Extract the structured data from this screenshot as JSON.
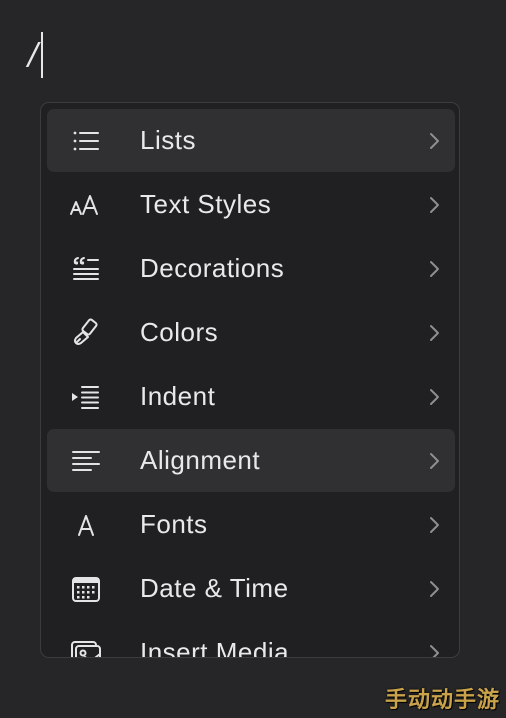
{
  "editor": {
    "typed_text": "/"
  },
  "menu": {
    "items": [
      {
        "label": "Lists",
        "icon": "list-icon",
        "highlighted": true
      },
      {
        "label": "Text Styles",
        "icon": "text-size-icon",
        "icon_text": "AA",
        "highlighted": false
      },
      {
        "label": "Decorations",
        "icon": "quote-lines-icon",
        "highlighted": false
      },
      {
        "label": "Colors",
        "icon": "paintbrush-icon",
        "highlighted": false
      },
      {
        "label": "Indent",
        "icon": "indent-icon",
        "highlighted": false
      },
      {
        "label": "Alignment",
        "icon": "align-left-icon",
        "highlighted": true
      },
      {
        "label": "Fonts",
        "icon": "font-icon",
        "icon_text": "A",
        "highlighted": false
      },
      {
        "label": "Date & Time",
        "icon": "calendar-icon",
        "highlighted": false
      },
      {
        "label": "Insert Media",
        "icon": "photo-icon",
        "highlighted": false
      }
    ]
  },
  "watermark": {
    "text": "手动动手游"
  },
  "colors": {
    "background": "#262628",
    "menu_background": "#202022",
    "highlight": "#303033",
    "text": "#e9e9eb",
    "chevron": "#8e8e93"
  }
}
